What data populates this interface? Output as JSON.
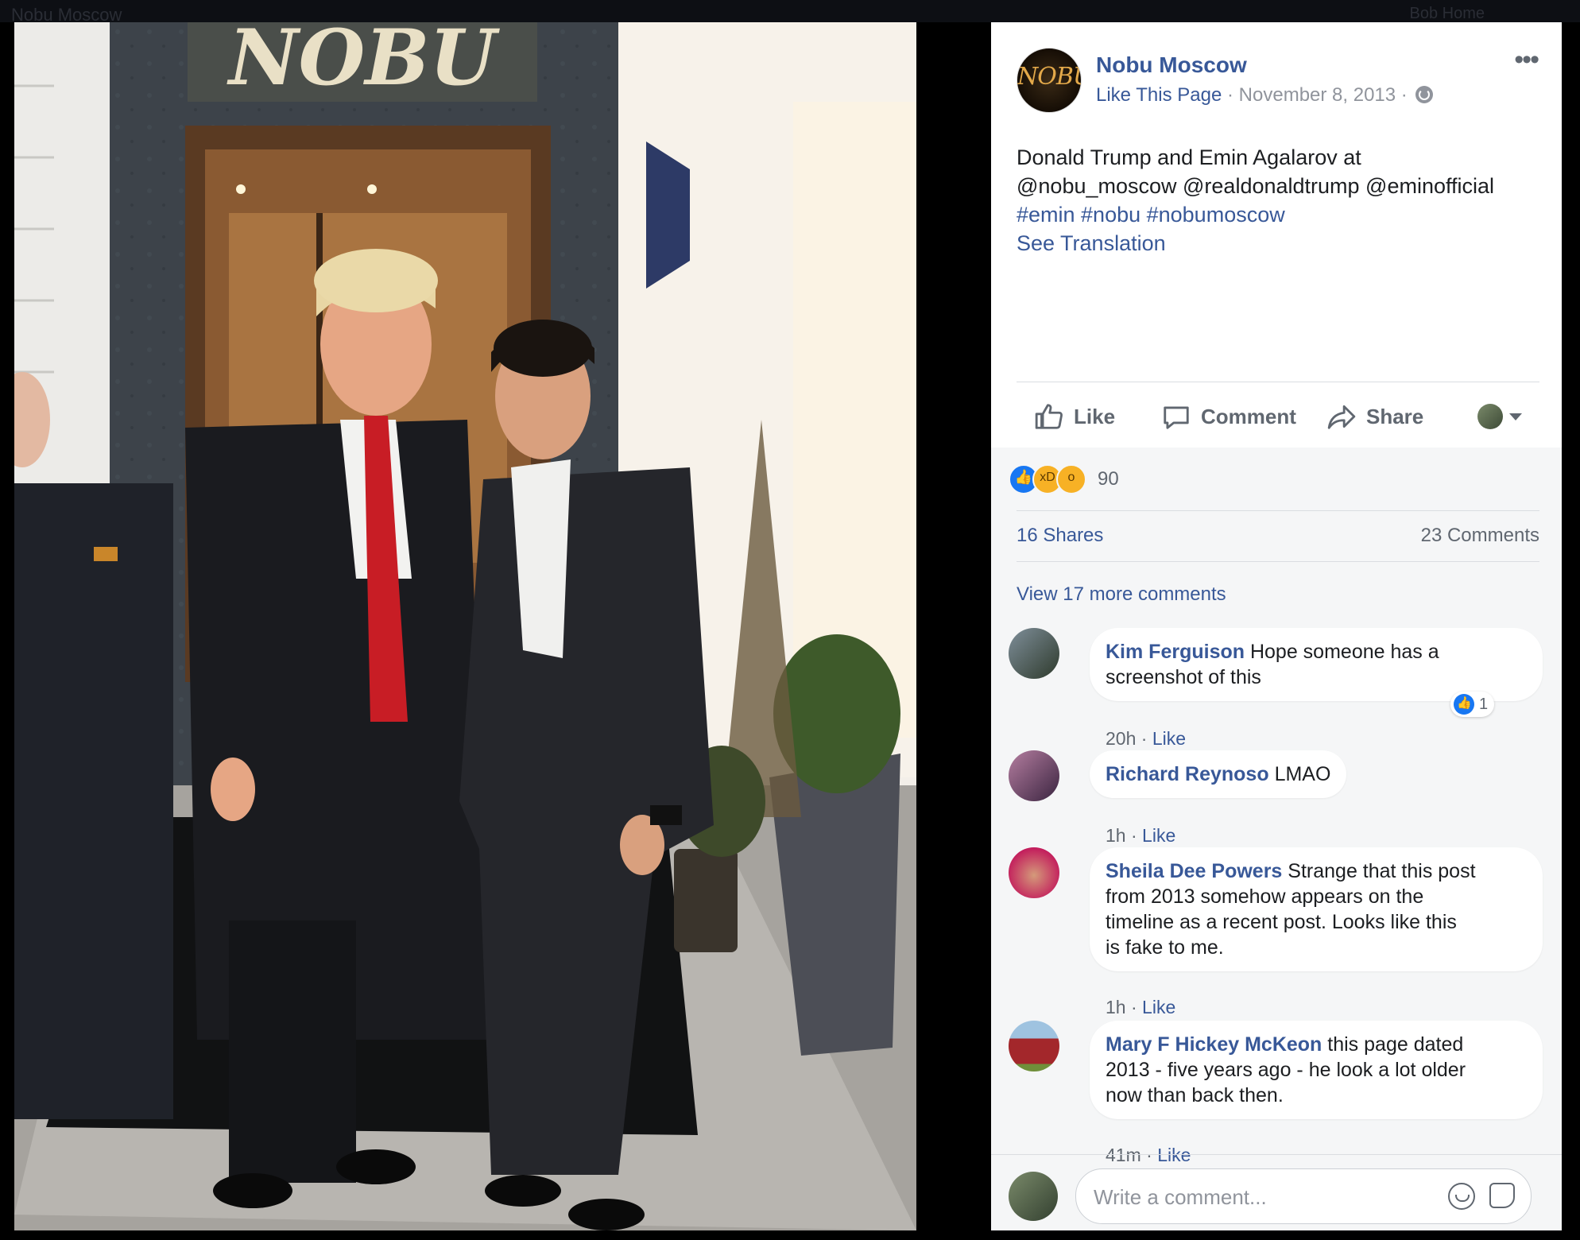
{
  "background": {
    "tab_title": "Nobu Moscow",
    "top_right": "Bob   Home"
  },
  "photo": {
    "sign_text": "NOBU",
    "colors": {
      "sign": "#e9e0c6",
      "coat": "#1a1b1f",
      "tie": "#c81d25",
      "suit": "#25262b",
      "wall": "#3d4349"
    }
  },
  "post": {
    "page_name": "Nobu Moscow",
    "page_avatar_text": "NOBU",
    "like_page": "Like This Page",
    "date": "November 8, 2013",
    "text_line1": "Donald Trump and Emin Agalarov at",
    "text_line2": "@nobu_moscow @realdonaldtrump @eminofficial",
    "hashtags": "#emin #nobu #nobumoscow",
    "see_translation": "See Translation"
  },
  "actions": {
    "like": "Like",
    "comment": "Comment",
    "share": "Share"
  },
  "reactions": {
    "count": "90",
    "types": [
      "like-icon",
      "haha-icon",
      "wow-icon"
    ]
  },
  "stats": {
    "shares": "16 Shares",
    "comments": "23 Comments"
  },
  "view_more": "View 17 more comments",
  "comments": [
    {
      "name": "Kim Ferguison",
      "text": "Hope someone has a",
      "text2": "screenshot of this",
      "time": "20h",
      "like": "Like",
      "reaction_count": "1"
    },
    {
      "name": "Richard Reynoso",
      "text": "LMAO",
      "time": "1h",
      "like": "Like"
    },
    {
      "name": "Sheila Dee Powers",
      "text": "Strange that this post",
      "text2": "from 2013 somehow appears on the",
      "text3": "timeline as a recent post. Looks like this",
      "text4": "is fake to me.",
      "time": "1h",
      "like": "Like"
    },
    {
      "name": "Mary F Hickey McKeon",
      "text": "this page dated",
      "text2": "2013 - five years ago - he look a lot older",
      "text3": "now than back then.",
      "time": "41m",
      "like": "Like"
    }
  ],
  "write_comment": {
    "placeholder": "Write a comment..."
  },
  "colors": {
    "link_blue": "#385898",
    "meta_gray": "#606770",
    "like_blue": "#1877f2"
  }
}
